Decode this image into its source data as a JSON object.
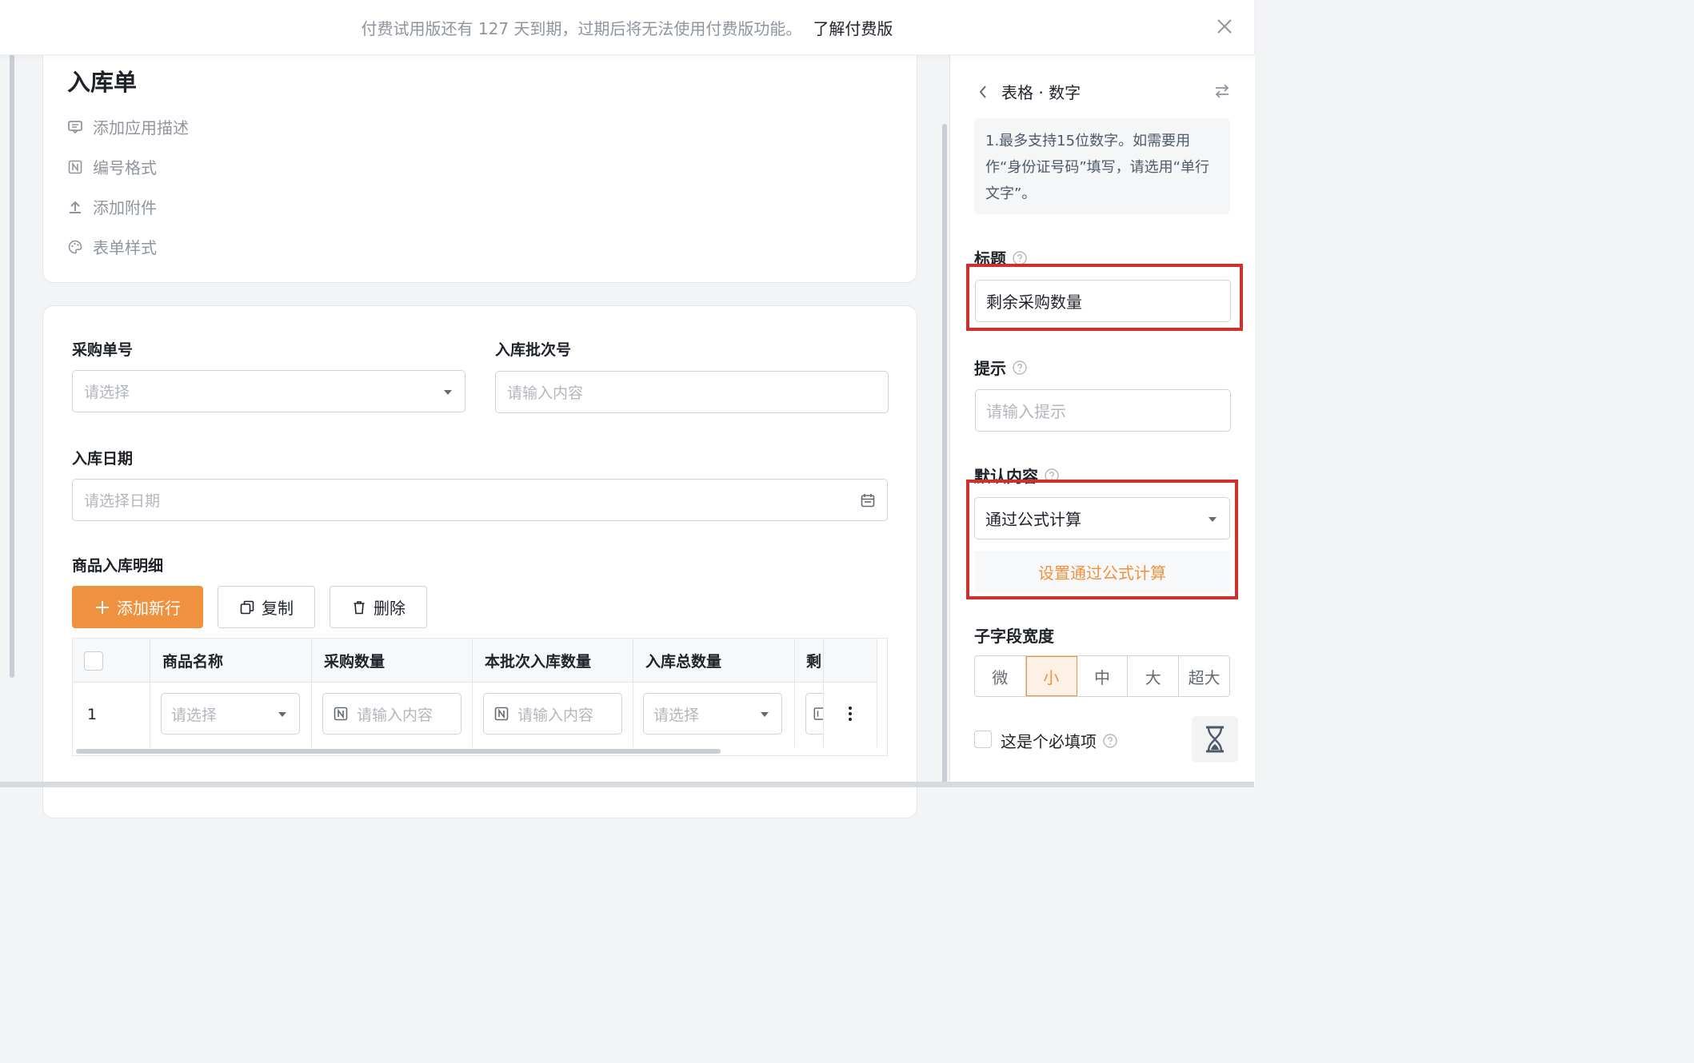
{
  "banner": {
    "message": "付费试用版还有 127 天到期，过期后将无法使用付费版功能。",
    "link": "了解付费版"
  },
  "form": {
    "title": "入库单",
    "menu": [
      {
        "label": "添加应用描述",
        "icon": "comment-icon"
      },
      {
        "label": "编号格式",
        "icon": "number-format-icon"
      },
      {
        "label": "添加附件",
        "icon": "upload-icon"
      },
      {
        "label": "表单样式",
        "icon": "palette-icon"
      }
    ],
    "fields": {
      "purchase_no": {
        "label": "采购单号",
        "placeholder": "请选择"
      },
      "batch_no": {
        "label": "入库批次号",
        "placeholder": "请输入内容"
      },
      "date": {
        "label": "入库日期",
        "placeholder": "请选择日期"
      }
    },
    "detail": {
      "label": "商品入库明细",
      "add_row": "添加新行",
      "copy": "复制",
      "delete": "删除",
      "columns": [
        "商品名称",
        "采购数量",
        "本批次入库数量",
        "入库总数量",
        "剩"
      ],
      "row": {
        "index": "1",
        "cells": [
          "请选择",
          "请输入内容",
          "请输入内容",
          "请选择"
        ]
      }
    }
  },
  "panel": {
    "header": "表格 · 数字",
    "info": "1.最多支持15位数字。如需要用作“身份证号码”填写，请选用“单行文字”。",
    "title_label": "标题",
    "title_value": "剩余采购数量",
    "hint_label": "提示",
    "hint_placeholder": "请输入提示",
    "default_label": "默认内容",
    "default_value": "通过公式计算",
    "formula_link": "设置通过公式计算",
    "width_label": "子字段宽度",
    "width_options": [
      "微",
      "小",
      "中",
      "大",
      "超大"
    ],
    "width_selected": "小",
    "required_label": "这是个必填项"
  },
  "colors": {
    "accent": "#f0913f",
    "highlight_box": "#d0302b"
  }
}
